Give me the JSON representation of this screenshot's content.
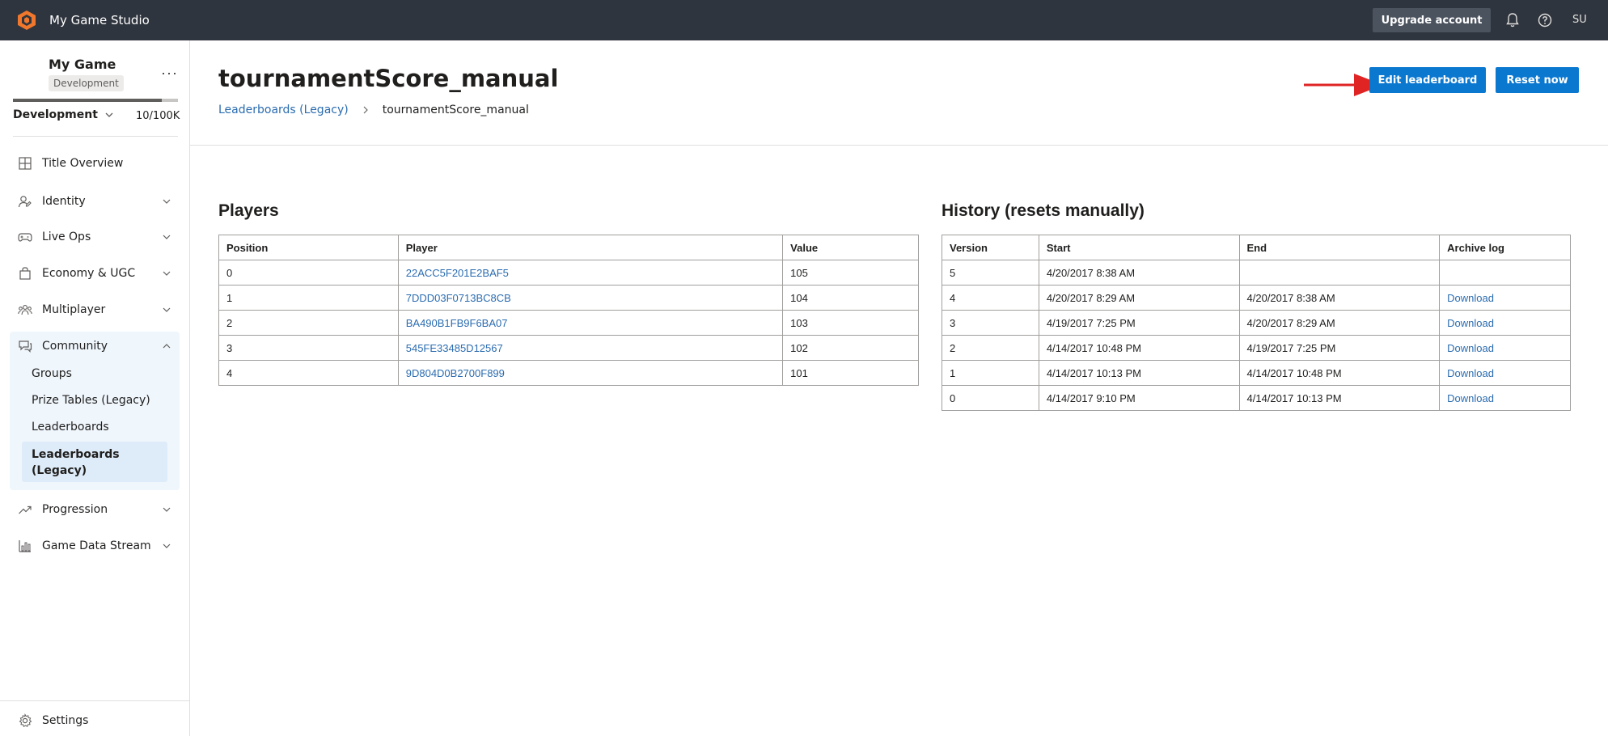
{
  "topbar": {
    "studio_name": "My Game Studio",
    "upgrade_label": "Upgrade account",
    "user_initials": "SU"
  },
  "sidebar": {
    "game_name": "My Game",
    "env_badge": "Development",
    "env_select": "Development",
    "usage": "10/100K",
    "usage_fraction": 0.9,
    "items": [
      {
        "label": "Title Overview"
      },
      {
        "label": "Identity"
      },
      {
        "label": "Live Ops"
      },
      {
        "label": "Economy & UGC"
      },
      {
        "label": "Multiplayer"
      },
      {
        "label": "Community"
      },
      {
        "label": "Progression"
      },
      {
        "label": "Game Data Stream"
      }
    ],
    "community_sub": [
      {
        "label": "Groups"
      },
      {
        "label": "Prize Tables (Legacy)"
      },
      {
        "label": "Leaderboards"
      },
      {
        "label": "Leaderboards (Legacy)"
      }
    ],
    "settings_label": "Settings"
  },
  "page": {
    "title": "tournamentScore_manual",
    "breadcrumb_parent": "Leaderboards (Legacy)",
    "breadcrumb_current": "tournamentScore_manual",
    "edit_label": "Edit leaderboard",
    "reset_label": "Reset now"
  },
  "players": {
    "title": "Players",
    "headers": [
      "Position",
      "Player",
      "Value"
    ],
    "rows": [
      {
        "position": "0",
        "player": "22ACC5F201E2BAF5",
        "value": "105"
      },
      {
        "position": "1",
        "player": "7DDD03F0713BC8CB",
        "value": "104"
      },
      {
        "position": "2",
        "player": "BA490B1FB9F6BA07",
        "value": "103"
      },
      {
        "position": "3",
        "player": "545FE33485D12567",
        "value": "102"
      },
      {
        "position": "4",
        "player": "9D804D0B2700F899",
        "value": "101"
      }
    ]
  },
  "history": {
    "title": "History (resets manually)",
    "headers": [
      "Version",
      "Start",
      "End",
      "Archive log"
    ],
    "rows": [
      {
        "version": "5",
        "start": "4/20/2017 8:38 AM",
        "end": "",
        "archive": ""
      },
      {
        "version": "4",
        "start": "4/20/2017 8:29 AM",
        "end": "4/20/2017 8:38 AM",
        "archive": "Download"
      },
      {
        "version": "3",
        "start": "4/19/2017 7:25 PM",
        "end": "4/20/2017 8:29 AM",
        "archive": "Download"
      },
      {
        "version": "2",
        "start": "4/14/2017 10:48 PM",
        "end": "4/19/2017 7:25 PM",
        "archive": "Download"
      },
      {
        "version": "1",
        "start": "4/14/2017 10:13 PM",
        "end": "4/14/2017 10:48 PM",
        "archive": "Download"
      },
      {
        "version": "0",
        "start": "4/14/2017 9:10 PM",
        "end": "4/14/2017 10:13 PM",
        "archive": "Download"
      }
    ]
  },
  "colors": {
    "topbar": "#2f353e",
    "primary": "#0b78d0",
    "link": "#2b6cb0",
    "annotation_arrow": "#e02424"
  }
}
